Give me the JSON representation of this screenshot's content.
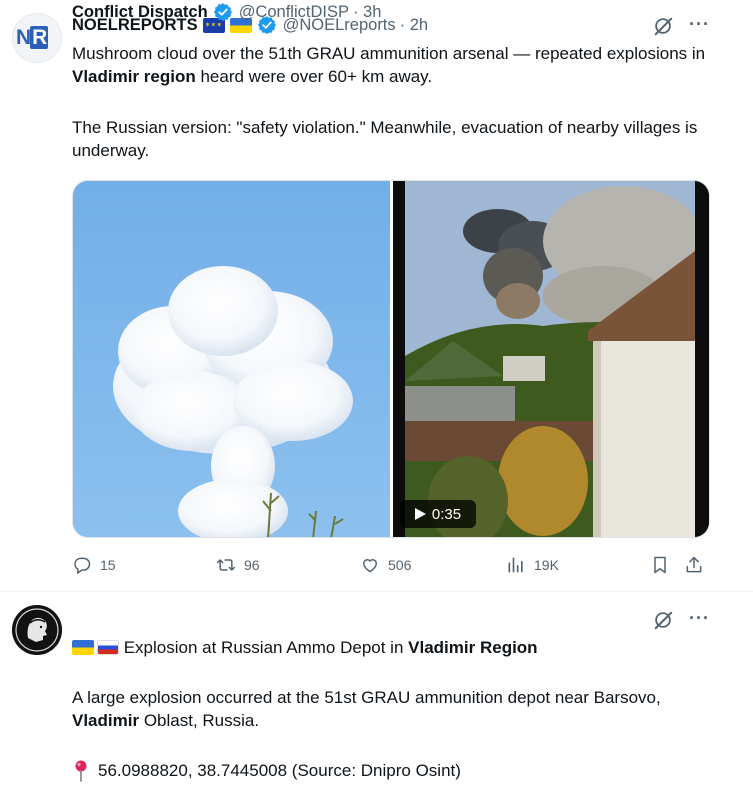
{
  "tweet1": {
    "name": "NOELREPORTS",
    "flags": [
      "eu-flag",
      "ukraine-flag"
    ],
    "handle": "@NOELreports",
    "time": "· 2h",
    "avatar_text_left": "N",
    "avatar_text_right": "R",
    "paragraph1": {
      "pre": "Mushroom cloud over the 51th GRAU ammunition arsenal — repeated explosions in ",
      "bold": "Vladimir region",
      "post": " heard were over 60+ km away."
    },
    "paragraph2": "The Russian version: \"safety violation.\" Meanwhile, evacuation of nearby villages is underway.",
    "video_duration": "0:35",
    "stats": {
      "replies": "15",
      "reposts": "96",
      "likes": "506",
      "views": "19K"
    }
  },
  "tweet2": {
    "name": "Conflict Dispatch",
    "handle": "@ConflictDISP",
    "time": "· 3h",
    "line1": {
      "pre": " Explosion at Russian Ammo Depot in ",
      "bold": "Vladimir Region"
    },
    "paragraph2": {
      "pre": "A large explosion occurred at the 51st GRAU ammunition depot near Barsovo, ",
      "bold": "Vladimir",
      "post": " Oblast, Russia."
    },
    "paragraph3": "56.0988820, 38.7445008 (Source: Dnipro Osint)"
  },
  "colors": {
    "text": "#0f1419",
    "secondary": "#536471",
    "verified": "#1d9bf0",
    "brand_blue": "#2b60b8"
  }
}
